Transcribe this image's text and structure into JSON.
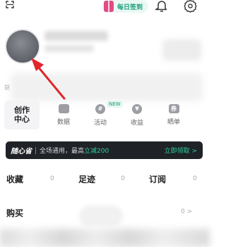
{
  "topbar": {
    "checkin_label": "每日签到"
  },
  "profile": {
    "desc_prefix": "获"
  },
  "creator": {
    "center_label": "创作中心",
    "items": [
      {
        "label": "数据",
        "icon": "chart-icon"
      },
      {
        "label": "活动",
        "icon": "hash-icon"
      },
      {
        "label": "收益",
        "icon": "yen-icon"
      },
      {
        "label": "晒单",
        "icon": "coupon-icon"
      }
    ],
    "new_badge": "NEW",
    "hash_glyph": "#",
    "yen_glyph": "¥",
    "coupon_glyph": "券"
  },
  "banner": {
    "brand": "随心省",
    "promo_text": "全场通用，最高",
    "promo_highlight": "立减200",
    "claim": "立即领取 >"
  },
  "stats": [
    {
      "label": "收藏",
      "value": "0"
    },
    {
      "label": "足迹",
      "value": "0"
    },
    {
      "label": "订阅",
      "value": "0"
    }
  ],
  "purchase": {
    "label": "购买",
    "count": "0 >"
  },
  "colors": {
    "accent": "#1c9e7c",
    "banner_bg": "#1f2226",
    "arrow": "#e0262b"
  }
}
